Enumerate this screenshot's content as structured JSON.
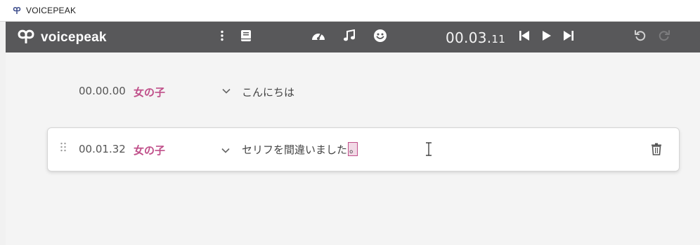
{
  "window": {
    "title": "VOICEPEAK",
    "icon": "voicepeak-logo-icon"
  },
  "toolbar": {
    "brand": "voicepeak",
    "icons": [
      "more-vertical-icon",
      "book-icon",
      "speedometer-icon",
      "music-note-icon",
      "smiley-icon",
      "skip-back-icon",
      "play-icon",
      "skip-forward-icon",
      "undo-icon",
      "redo-icon"
    ],
    "timecode_main": "00.03.",
    "timecode_frac": "11"
  },
  "rows": [
    {
      "time": "00.00.00",
      "speaker": "女の子",
      "text": "こんにちは"
    },
    {
      "time": "00.01.32",
      "speaker": "女の子",
      "text": "セリフを間違いました",
      "selected_char": "。"
    }
  ],
  "colors": {
    "toolbar_bg": "#58585a",
    "speaker": "#c0508a",
    "canvas_bg": "#f4f4f4"
  }
}
